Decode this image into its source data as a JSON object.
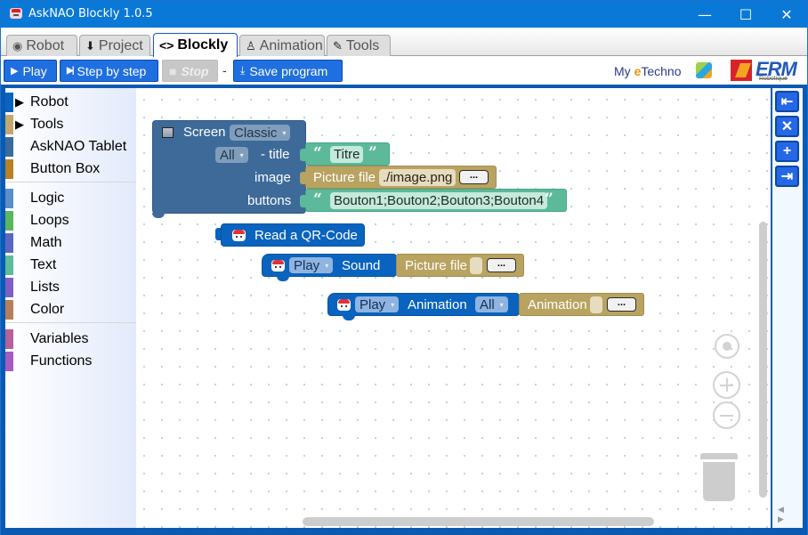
{
  "window": {
    "title": "AskNAO Blockly 1.0.5",
    "controls": {
      "minimize": "—",
      "maximize": "☐",
      "close": "✕"
    }
  },
  "tabs": [
    {
      "label": "Robot",
      "icon": "robot-icon",
      "glyph": "◉",
      "active": false
    },
    {
      "label": "Project",
      "icon": "download-icon",
      "glyph": "⬇",
      "active": false
    },
    {
      "label": "Blockly",
      "icon": "code-icon",
      "glyph": "<>",
      "active": true
    },
    {
      "label": "Animation",
      "icon": "figure-icon",
      "glyph": "♙",
      "active": false
    },
    {
      "label": "Tools",
      "icon": "edit-icon",
      "glyph": "✎",
      "active": false
    }
  ],
  "toolbar": {
    "play_label": "Play",
    "play_glyph": "▶",
    "step_label": "Step by step",
    "step_glyph": "▶|",
    "stop_label": "Stop",
    "stop_glyph": "■",
    "separator": "-",
    "save_label": "Save program",
    "save_glyph": "⤓"
  },
  "logos": {
    "myetechno_prefix": "My ",
    "myetechno_e": "e",
    "myetechno_rest": "Techno",
    "erm_text": "ERM",
    "erm_sub": "Robotique"
  },
  "toolbox": {
    "categories": [
      {
        "label": "Robot",
        "color": "#0a63be",
        "expandable": true
      },
      {
        "label": "Tools",
        "color": "#c2a86a",
        "expandable": true
      },
      {
        "label": "AskNAO Tablet",
        "color": "#3a6b9c",
        "expandable": false
      },
      {
        "label": "Button Box",
        "color": "#b98024",
        "expandable": false
      },
      {
        "label": "Logic",
        "color": "#5b8fc6",
        "expandable": false
      },
      {
        "label": "Loops",
        "color": "#5cb75c",
        "expandable": false
      },
      {
        "label": "Math",
        "color": "#5b67c4",
        "expandable": false
      },
      {
        "label": "Text",
        "color": "#5cbd9b",
        "expandable": false
      },
      {
        "label": "Lists",
        "color": "#7e5fc3",
        "expandable": false
      },
      {
        "label": "Color",
        "color": "#b97d5c",
        "expandable": false
      },
      {
        "label": "Variables",
        "color": "#b9609a",
        "expandable": false
      },
      {
        "label": "Functions",
        "color": "#a55bc1",
        "expandable": false
      }
    ],
    "expand_glyph": "▶"
  },
  "blocks": {
    "screen": {
      "label": "Screen",
      "mode": "Classic",
      "title_target": "All",
      "title_label": "- title",
      "image_label": "image",
      "buttons_label": "buttons",
      "title_value": "Titre",
      "image_block_label": "Picture file",
      "image_value": "./image.png",
      "buttons_value": "Bouton1;Bouton2;Bouton3;Bouton4",
      "browse_label": "..."
    },
    "qr": {
      "label": "Read a QR-Code"
    },
    "sound": {
      "action": "Play",
      "label": "Sound",
      "file_label": "Picture file",
      "file_value": "",
      "browse_label": "..."
    },
    "animation": {
      "action": "Play",
      "label": "Animation",
      "target": "All",
      "file_label": "Animation",
      "file_value": "",
      "browse_label": "..."
    },
    "quote_open": "“",
    "quote_close": "”",
    "caret": "▾"
  },
  "sidebar_buttons": [
    {
      "name": "collapse-left",
      "glyph": "⇤"
    },
    {
      "name": "delete",
      "glyph": "✕"
    },
    {
      "name": "add",
      "glyph": "+"
    },
    {
      "name": "expand-right",
      "glyph": "⇥"
    }
  ],
  "scroll_arrows": "◀ ▶"
}
